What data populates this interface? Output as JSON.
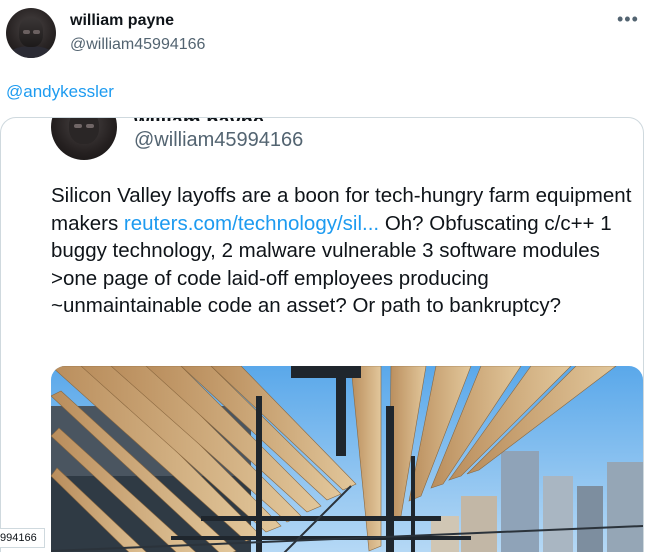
{
  "tweet": {
    "display_name": "william payne",
    "handle": "@william45994166",
    "more_icon": "more-horizontal-icon",
    "mention": "@andykessler"
  },
  "quoted": {
    "handle": "@william45994166",
    "text_before_link": "Silicon Valley layoffs are a boon for tech-hungry farm equipment makers ",
    "link_text": "reuters.com/technology/sil...",
    "text_after_link": " Oh? Obfuscating c/c++ 1 buggy technology, 2 malware vulnerable 3 software modules >one page of code laid-off employees producing ~unmaintainable code an asset? Or path to  bankruptcy?",
    "media_alt": "pergola-city-skyline-photo"
  },
  "side_tab": {
    "text": "994166"
  },
  "colors": {
    "link": "#1d9bf0",
    "text_primary": "#0f1419",
    "text_secondary": "#536471",
    "border": "#cfd9de"
  }
}
